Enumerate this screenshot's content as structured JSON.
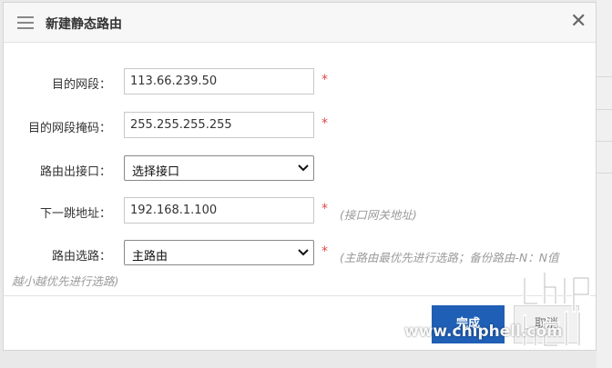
{
  "dialog": {
    "title": "新建静态路由",
    "close_glyph": "✕"
  },
  "form": {
    "dest_network": {
      "label": "目的网段：",
      "value": "113.66.239.50"
    },
    "dest_mask": {
      "label": "目的网段掩码：",
      "value": "255.255.255.255"
    },
    "out_interface": {
      "label": "路由出接口：",
      "selected": "选择接口"
    },
    "next_hop": {
      "label": "下一跳地址：",
      "value": "192.168.1.100",
      "hint": "(接口网关地址)"
    },
    "route_type": {
      "label": "路由选路：",
      "selected": "主路由",
      "hint_line1": "(主路由最优先进行选路；备份路由-N：N值",
      "hint_line2": "越小越优先进行选路)"
    },
    "required_mark": "*"
  },
  "footer": {
    "done_label": "完成",
    "cancel_label": "取消"
  },
  "watermark": {
    "text": "www.chiphell.com",
    "logo_text": "chip hell"
  },
  "colors": {
    "primary_button": "#1f5fb5",
    "required": "#e04848",
    "hint": "#9a9a9a"
  },
  "icons": {
    "menu": "menu-icon",
    "close": "close-icon",
    "dropdown": "chevron-down-icon"
  }
}
